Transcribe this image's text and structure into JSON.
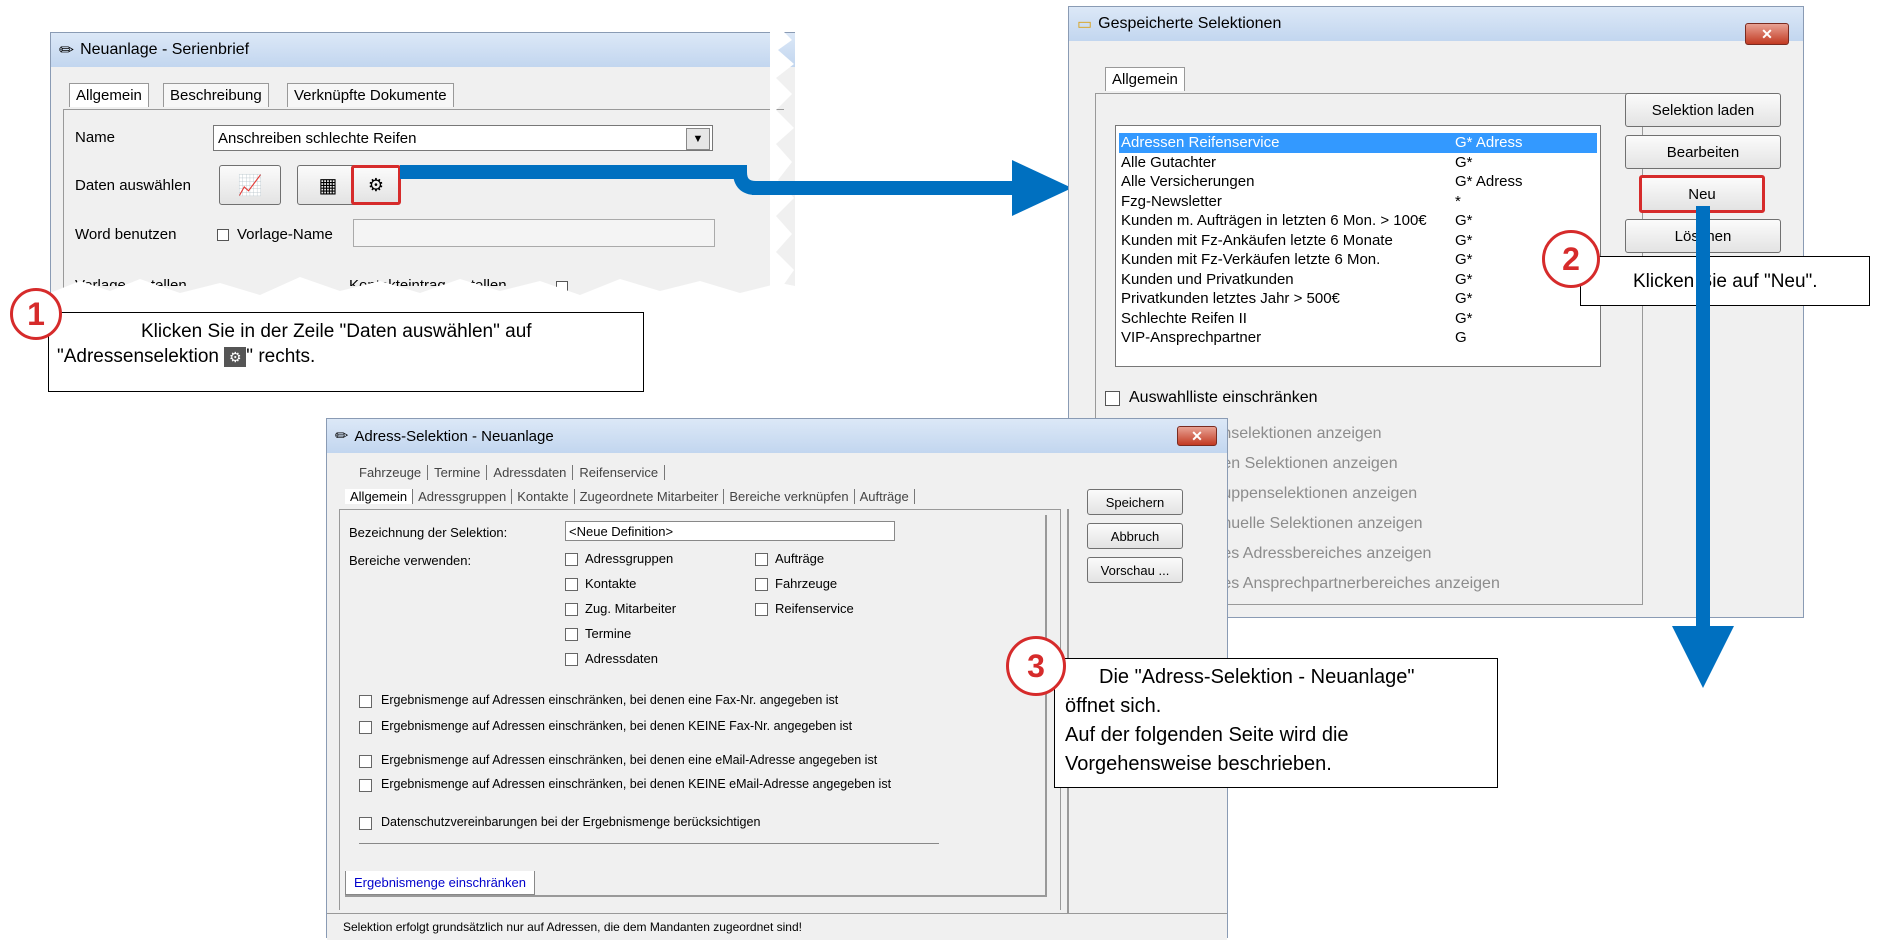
{
  "win1": {
    "title": "Neuanlage - Serienbrief",
    "tabs": [
      "Allgemein",
      "Beschreibung",
      "Verknüpfte Dokumente"
    ],
    "name_label": "Name",
    "name_value": "Anschreiben schlechte Reifen",
    "daten_label": "Daten auswählen",
    "word_label": "Word benutzen",
    "vorlage_name_label": "Vorlage-Name",
    "vorlage_erstellen_label": "Vorlage erstellen",
    "kontakt_label": "Kontakteintrag erstellen"
  },
  "callout1": {
    "number": "1",
    "text_a": "Klicken Sie in der Zeile \"Daten auswählen\" auf",
    "text_b": "\"Adressenselektion",
    "text_c": "\" rechts."
  },
  "win2": {
    "title": "Gespeicherte Selektionen",
    "tab": "Allgemein",
    "items": [
      {
        "name": "Adressen Reifenservice",
        "flag": "G* Adress"
      },
      {
        "name": "Alle Gutachter",
        "flag": "G*"
      },
      {
        "name": "Alle Versicherungen",
        "flag": "G* Adress"
      },
      {
        "name": "Fzg-Newsletter",
        "flag": "*"
      },
      {
        "name": "Kunden m. Aufträgen in letzten 6 Mon. > 100€",
        "flag": "G*"
      },
      {
        "name": "Kunden mit Fz-Ankäufen letzte 6 Monate",
        "flag": "G*"
      },
      {
        "name": "Kunden mit Fz-Verkäufen letzte 6 Mon.",
        "flag": "G*"
      },
      {
        "name": "Kunden und Privatkunden",
        "flag": "G*"
      },
      {
        "name": "Privatkunden letztes Jahr > 500€",
        "flag": "G*"
      },
      {
        "name": "Schlechte Reifen II",
        "flag": "G*"
      },
      {
        "name": "VIP-Ansprechpartner",
        "flag": "G"
      }
    ],
    "btn_laden": "Selektion laden",
    "btn_bearbeiten": "Bearbeiten",
    "btn_neu": "Neu",
    "btn_loeschen": "Löschen",
    "auswahl": "Auswahlliste einschränken",
    "options": [
      "...nselektionen anzeigen",
      "...en Selektionen anzeigen",
      "...uppenselektionen anzeigen",
      "...nuelle Selektionen anzeigen",
      "...es Adressbereiches anzeigen",
      "...es Ansprechpartnerbereiches anzeigen"
    ]
  },
  "callout2": {
    "number": "2",
    "text": "Klicken Sie auf \"Neu\"."
  },
  "win3": {
    "title": "Adress-Selektion - Neuanlage",
    "tabs_row1": [
      "Fahrzeuge",
      "Termine",
      "Adressdaten",
      "Reifenservice"
    ],
    "tabs_row2": [
      "Allgemein",
      "Adressgruppen",
      "Kontakte",
      "Zugeordnete Mitarbeiter",
      "Bereiche verknüpfen",
      "Aufträge"
    ],
    "bezeichnung_label": "Bezeichnung der Selektion:",
    "bezeichnung_value": "<Neue Definition>",
    "bereiche_label": "Bereiche verwenden:",
    "col1": [
      "Adressgruppen",
      "Kontakte",
      "Zug. Mitarbeiter",
      "Termine",
      "Adressdaten"
    ],
    "col2": [
      "Aufträge",
      "Fahrzeuge",
      "Reifenservice"
    ],
    "checks": [
      "Ergebnismenge auf Adressen einschränken, bei denen eine Fax-Nr. angegeben ist",
      "Ergebnismenge auf Adressen einschränken, bei denen KEINE Fax-Nr. angegeben ist",
      "Ergebnismenge auf Adressen einschränken, bei denen eine eMail-Adresse angegeben ist",
      "Ergebnismenge auf Adressen einschränken, bei denen KEINE eMail-Adresse angegeben ist",
      "Datenschutzvereinbarungen bei der Ergebnismenge berücksichtigen"
    ],
    "bottom_tab": "Ergebnismenge einschränken",
    "btn_speichern": "Speichern",
    "btn_abbruch": "Abbruch",
    "btn_vorschau": "Vorschau ...",
    "status": "Selektion erfolgt grundsätzlich nur auf Adressen, die dem Mandanten zugeordnet sind!"
  },
  "callout3": {
    "number": "3",
    "line1": "Die \"Adress-Selektion - Neuanlage\"",
    "line2": "öffnet sich.",
    "line3": "Auf der folgenden Seite wird die",
    "line4": "Vorgehensweise beschrieben."
  },
  "colors": {
    "accent": "#0070c0",
    "highlight": "#d62b2b",
    "selection": "#3399ff"
  }
}
